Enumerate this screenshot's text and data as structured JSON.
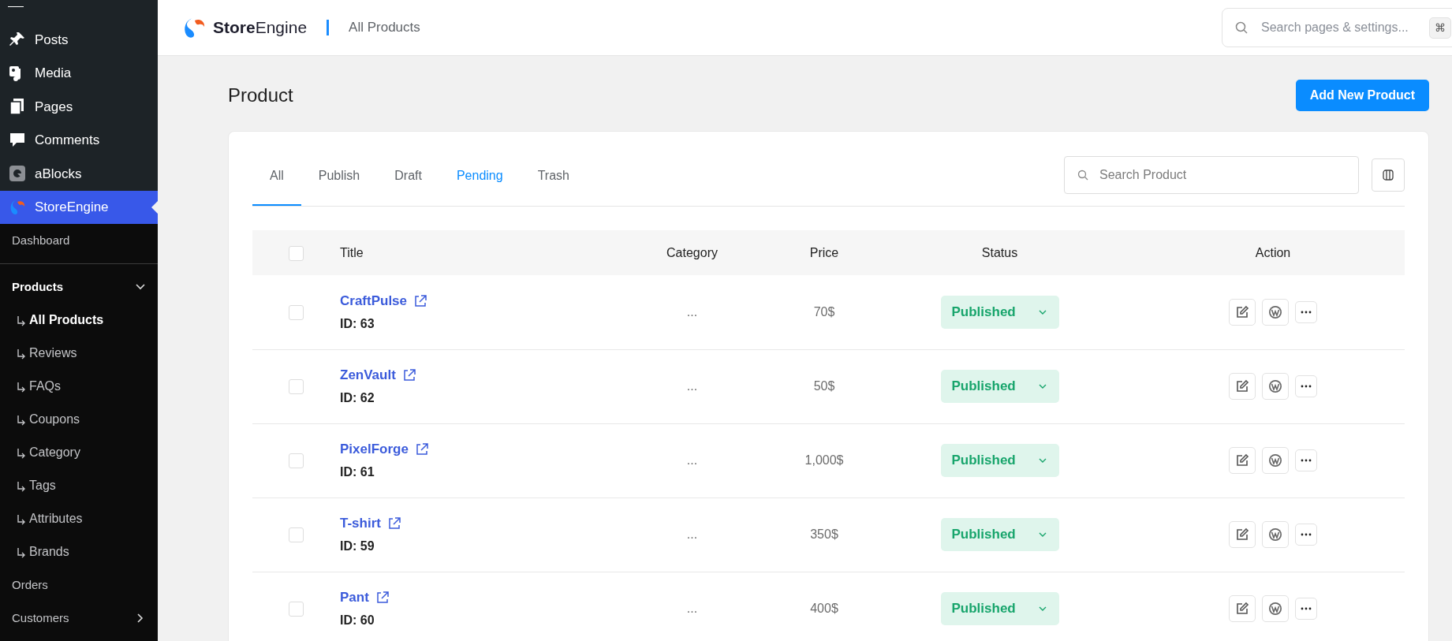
{
  "sidebar": {
    "menu": [
      {
        "label": "Posts",
        "selected": false
      },
      {
        "label": "Media",
        "selected": false
      },
      {
        "label": "Pages",
        "selected": false
      },
      {
        "label": "Comments",
        "selected": false
      },
      {
        "label": "aBlocks",
        "selected": false
      },
      {
        "label": "StoreEngine",
        "selected": true
      }
    ],
    "submenu": [
      {
        "label": "Dashboard"
      },
      {
        "label": "Products",
        "expanded": true,
        "children": [
          {
            "label": "All Products",
            "selected": true
          },
          {
            "label": "Reviews",
            "selected": false
          },
          {
            "label": "FAQs",
            "selected": false
          },
          {
            "label": "Coupons",
            "selected": false
          },
          {
            "label": "Category",
            "selected": false
          },
          {
            "label": "Tags",
            "selected": false
          },
          {
            "label": "Attributes",
            "selected": false
          },
          {
            "label": "Brands",
            "selected": false
          }
        ]
      },
      {
        "label": "Orders"
      },
      {
        "label": "Customers",
        "expanded": false
      }
    ]
  },
  "header": {
    "brand": "**Store**Engine",
    "breadcrumb": "All Products",
    "search": {
      "placeholder": "Search pages & settings...",
      "shortcut": "⌘"
    }
  },
  "page": {
    "title": "Product",
    "add_button": "Add New Product"
  },
  "tabs": [
    {
      "label": "All",
      "selected": true,
      "hovered": false
    },
    {
      "label": "Publish",
      "selected": false,
      "hovered": false
    },
    {
      "label": "Draft",
      "selected": false,
      "hovered": false
    },
    {
      "label": "Pending",
      "selected": false,
      "hovered": true
    },
    {
      "label": "Trash",
      "selected": false,
      "hovered": false
    }
  ],
  "product_search": {
    "placeholder": "Search Product"
  },
  "table": {
    "select_all_checked": false,
    "columns": [
      "Title",
      "Category",
      "Price",
      "Status",
      "Action"
    ],
    "rows": [
      {
        "checked": false,
        "title": "CraftPulse",
        "id": "ID: 63",
        "category": "...",
        "price": "70$",
        "status": "Published"
      },
      {
        "checked": false,
        "title": "ZenVault",
        "id": "ID: 62",
        "category": "...",
        "price": "50$",
        "status": "Published"
      },
      {
        "checked": false,
        "title": "PixelForge",
        "id": "ID: 61",
        "category": "...",
        "price": "1,000$",
        "status": "Published"
      },
      {
        "checked": false,
        "title": "T-shirt",
        "id": "ID: 59",
        "category": "...",
        "price": "350$",
        "status": "Published"
      },
      {
        "checked": false,
        "title": "Pant",
        "id": "ID: 60",
        "category": "...",
        "price": "400$",
        "status": "Published"
      }
    ]
  }
}
